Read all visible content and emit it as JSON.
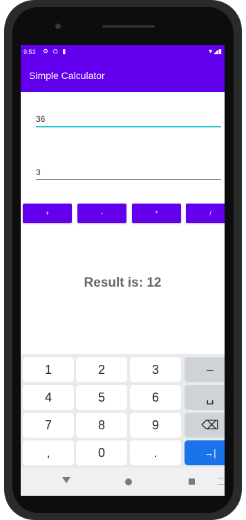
{
  "status_bar": {
    "time": "9:53",
    "left_icons": "⚙ ⛭ ▮",
    "right_icons": "▼◢▮"
  },
  "app_bar": {
    "title": "Simple Calculator"
  },
  "inputs": {
    "first_value": "36",
    "second_value": "3"
  },
  "operations": [
    {
      "label": "+"
    },
    {
      "label": "-"
    },
    {
      "label": "*"
    },
    {
      "label": "/"
    }
  ],
  "result": {
    "text": "Result is: 12"
  },
  "keyboard": {
    "rows": [
      [
        "1",
        "2",
        "3",
        "–"
      ],
      [
        "4",
        "5",
        "6",
        "␣"
      ],
      [
        "7",
        "8",
        "9",
        "⌫"
      ],
      [
        ",",
        "0",
        ".",
        "→|"
      ]
    ]
  },
  "colors": {
    "primary": "#6200ee",
    "accent": "#26c6da",
    "go_key": "#1a73e8"
  }
}
